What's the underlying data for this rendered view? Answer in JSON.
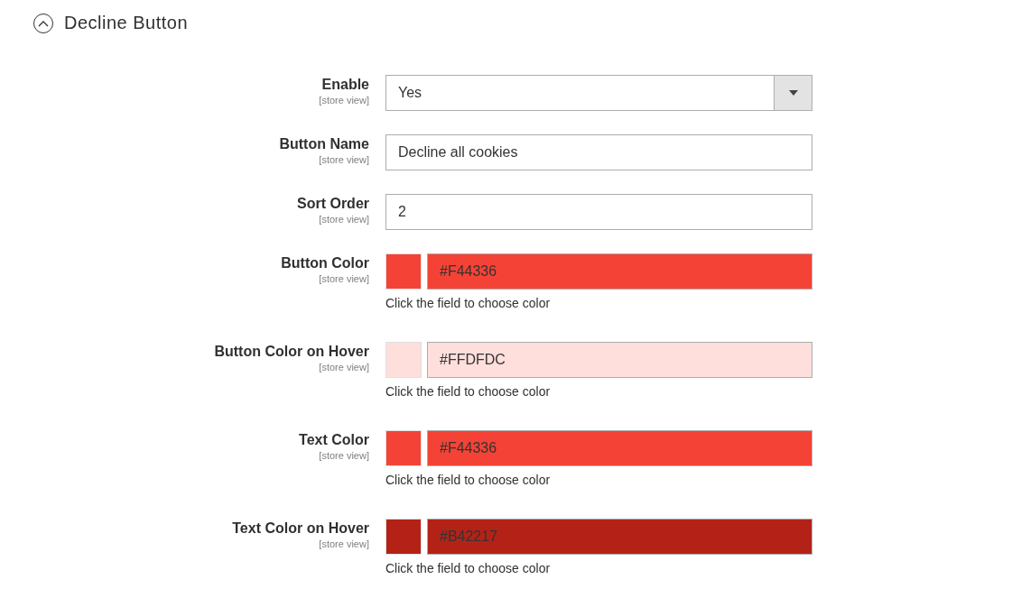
{
  "section": {
    "title": "Decline Button",
    "expanded": true
  },
  "fields": [
    {
      "kind": "select",
      "label": "Enable",
      "scope": "[store view]",
      "value": "Yes"
    },
    {
      "kind": "text",
      "label": "Button Name",
      "scope": "[store view]",
      "value": "Decline all cookies"
    },
    {
      "kind": "text",
      "label": "Sort Order",
      "scope": "[store view]",
      "value": "2"
    },
    {
      "kind": "color",
      "label": "Button Color",
      "scope": "[store view]",
      "value": "#F44336",
      "color": "#f44336",
      "note": "Click the field to choose color"
    },
    {
      "kind": "color",
      "label": "Button Color on Hover",
      "scope": "[store view]",
      "value": "#FFDFDC",
      "color": "#ffdfdc",
      "note": "Click the field to choose color"
    },
    {
      "kind": "color",
      "label": "Text Color",
      "scope": "[store view]",
      "value": "#F44336",
      "color": "#f44336",
      "note": "Click the field to choose color"
    },
    {
      "kind": "color",
      "label": "Text Color on Hover",
      "scope": "[store view]",
      "value": "#B42217",
      "color": "#b42217",
      "note": "Click the field to choose color"
    }
  ]
}
